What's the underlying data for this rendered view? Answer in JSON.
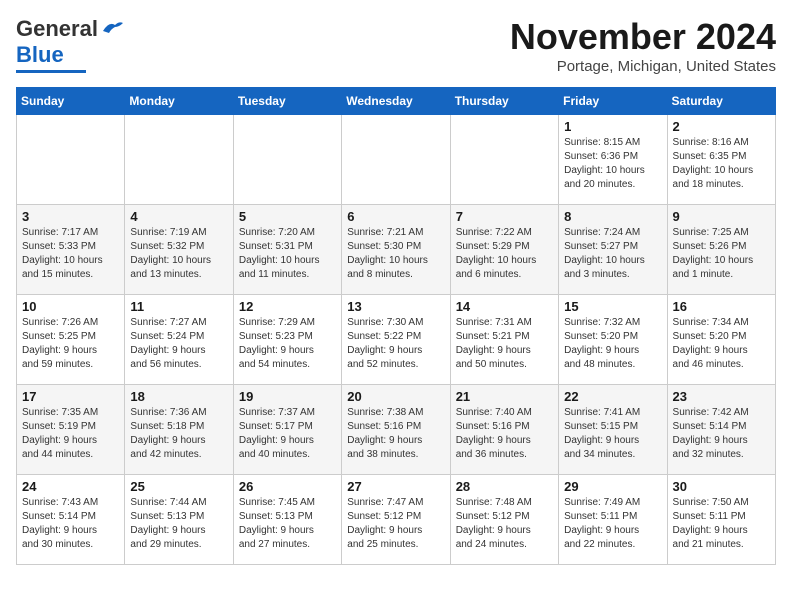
{
  "header": {
    "logo_general": "General",
    "logo_blue": "Blue",
    "month_title": "November 2024",
    "location": "Portage, Michigan, United States"
  },
  "calendar": {
    "days_of_week": [
      "Sunday",
      "Monday",
      "Tuesday",
      "Wednesday",
      "Thursday",
      "Friday",
      "Saturday"
    ],
    "weeks": [
      [
        {
          "day": "",
          "info": ""
        },
        {
          "day": "",
          "info": ""
        },
        {
          "day": "",
          "info": ""
        },
        {
          "day": "",
          "info": ""
        },
        {
          "day": "",
          "info": ""
        },
        {
          "day": "1",
          "info": "Sunrise: 8:15 AM\nSunset: 6:36 PM\nDaylight: 10 hours\nand 20 minutes."
        },
        {
          "day": "2",
          "info": "Sunrise: 8:16 AM\nSunset: 6:35 PM\nDaylight: 10 hours\nand 18 minutes."
        }
      ],
      [
        {
          "day": "3",
          "info": "Sunrise: 7:17 AM\nSunset: 5:33 PM\nDaylight: 10 hours\nand 15 minutes."
        },
        {
          "day": "4",
          "info": "Sunrise: 7:19 AM\nSunset: 5:32 PM\nDaylight: 10 hours\nand 13 minutes."
        },
        {
          "day": "5",
          "info": "Sunrise: 7:20 AM\nSunset: 5:31 PM\nDaylight: 10 hours\nand 11 minutes."
        },
        {
          "day": "6",
          "info": "Sunrise: 7:21 AM\nSunset: 5:30 PM\nDaylight: 10 hours\nand 8 minutes."
        },
        {
          "day": "7",
          "info": "Sunrise: 7:22 AM\nSunset: 5:29 PM\nDaylight: 10 hours\nand 6 minutes."
        },
        {
          "day": "8",
          "info": "Sunrise: 7:24 AM\nSunset: 5:27 PM\nDaylight: 10 hours\nand 3 minutes."
        },
        {
          "day": "9",
          "info": "Sunrise: 7:25 AM\nSunset: 5:26 PM\nDaylight: 10 hours\nand 1 minute."
        }
      ],
      [
        {
          "day": "10",
          "info": "Sunrise: 7:26 AM\nSunset: 5:25 PM\nDaylight: 9 hours\nand 59 minutes."
        },
        {
          "day": "11",
          "info": "Sunrise: 7:27 AM\nSunset: 5:24 PM\nDaylight: 9 hours\nand 56 minutes."
        },
        {
          "day": "12",
          "info": "Sunrise: 7:29 AM\nSunset: 5:23 PM\nDaylight: 9 hours\nand 54 minutes."
        },
        {
          "day": "13",
          "info": "Sunrise: 7:30 AM\nSunset: 5:22 PM\nDaylight: 9 hours\nand 52 minutes."
        },
        {
          "day": "14",
          "info": "Sunrise: 7:31 AM\nSunset: 5:21 PM\nDaylight: 9 hours\nand 50 minutes."
        },
        {
          "day": "15",
          "info": "Sunrise: 7:32 AM\nSunset: 5:20 PM\nDaylight: 9 hours\nand 48 minutes."
        },
        {
          "day": "16",
          "info": "Sunrise: 7:34 AM\nSunset: 5:20 PM\nDaylight: 9 hours\nand 46 minutes."
        }
      ],
      [
        {
          "day": "17",
          "info": "Sunrise: 7:35 AM\nSunset: 5:19 PM\nDaylight: 9 hours\nand 44 minutes."
        },
        {
          "day": "18",
          "info": "Sunrise: 7:36 AM\nSunset: 5:18 PM\nDaylight: 9 hours\nand 42 minutes."
        },
        {
          "day": "19",
          "info": "Sunrise: 7:37 AM\nSunset: 5:17 PM\nDaylight: 9 hours\nand 40 minutes."
        },
        {
          "day": "20",
          "info": "Sunrise: 7:38 AM\nSunset: 5:16 PM\nDaylight: 9 hours\nand 38 minutes."
        },
        {
          "day": "21",
          "info": "Sunrise: 7:40 AM\nSunset: 5:16 PM\nDaylight: 9 hours\nand 36 minutes."
        },
        {
          "day": "22",
          "info": "Sunrise: 7:41 AM\nSunset: 5:15 PM\nDaylight: 9 hours\nand 34 minutes."
        },
        {
          "day": "23",
          "info": "Sunrise: 7:42 AM\nSunset: 5:14 PM\nDaylight: 9 hours\nand 32 minutes."
        }
      ],
      [
        {
          "day": "24",
          "info": "Sunrise: 7:43 AM\nSunset: 5:14 PM\nDaylight: 9 hours\nand 30 minutes."
        },
        {
          "day": "25",
          "info": "Sunrise: 7:44 AM\nSunset: 5:13 PM\nDaylight: 9 hours\nand 29 minutes."
        },
        {
          "day": "26",
          "info": "Sunrise: 7:45 AM\nSunset: 5:13 PM\nDaylight: 9 hours\nand 27 minutes."
        },
        {
          "day": "27",
          "info": "Sunrise: 7:47 AM\nSunset: 5:12 PM\nDaylight: 9 hours\nand 25 minutes."
        },
        {
          "day": "28",
          "info": "Sunrise: 7:48 AM\nSunset: 5:12 PM\nDaylight: 9 hours\nand 24 minutes."
        },
        {
          "day": "29",
          "info": "Sunrise: 7:49 AM\nSunset: 5:11 PM\nDaylight: 9 hours\nand 22 minutes."
        },
        {
          "day": "30",
          "info": "Sunrise: 7:50 AM\nSunset: 5:11 PM\nDaylight: 9 hours\nand 21 minutes."
        }
      ]
    ]
  }
}
